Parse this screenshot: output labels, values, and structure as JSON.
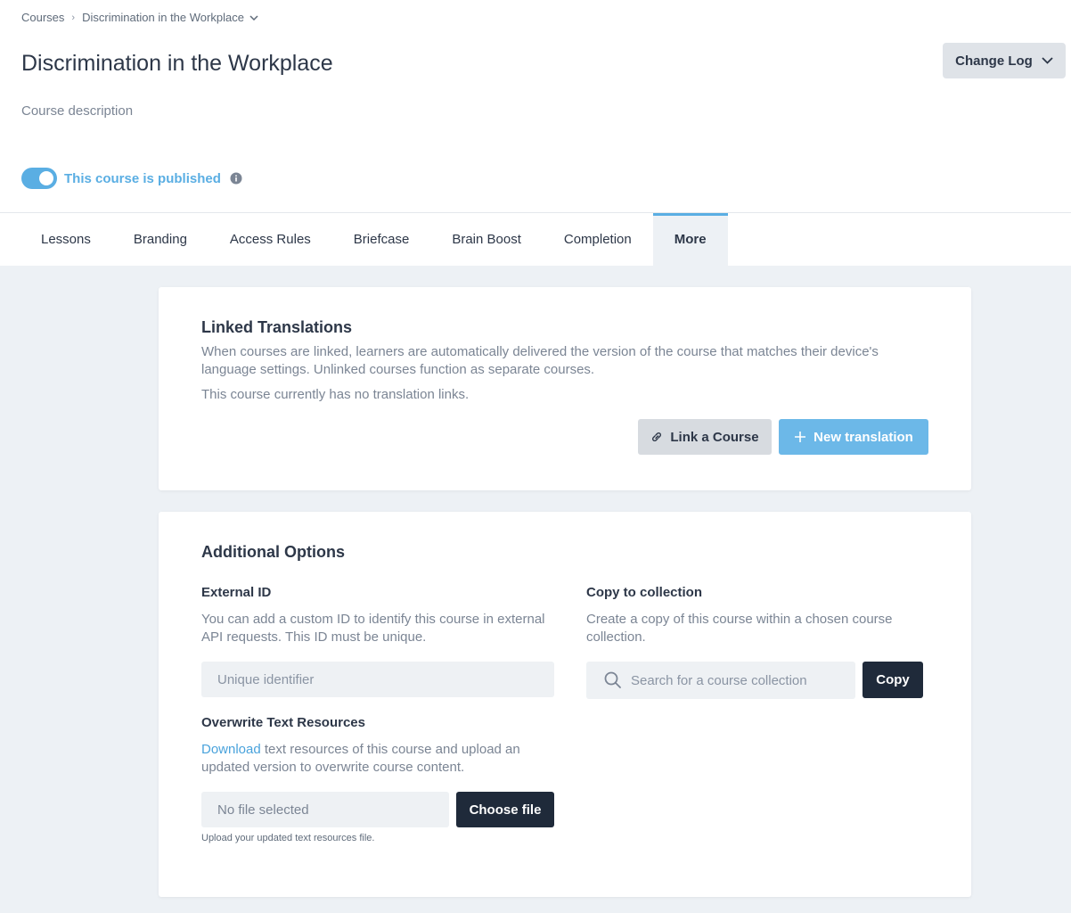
{
  "breadcrumb": {
    "root": "Courses",
    "current": "Discrimination in the Workplace"
  },
  "header": {
    "title": "Discrimination in the Workplace",
    "description": "Course description",
    "change_log_label": "Change Log",
    "publish_status": "This course is published"
  },
  "tabs": [
    {
      "label": "Lessons"
    },
    {
      "label": "Branding"
    },
    {
      "label": "Access Rules"
    },
    {
      "label": "Briefcase"
    },
    {
      "label": "Brain Boost"
    },
    {
      "label": "Completion"
    },
    {
      "label": "More"
    }
  ],
  "linked_translations": {
    "title": "Linked Translations",
    "description": "When courses are linked, learners are automatically delivered the version of the course that matches their device's language settings. Unlinked courses function as separate courses.",
    "status": "This course currently has no translation links.",
    "link_button": "Link a Course",
    "new_button": "New translation"
  },
  "additional_options": {
    "title": "Additional Options",
    "external_id": {
      "label": "External ID",
      "description": "You can add a custom ID to identify this course in external API requests. This ID must be unique.",
      "placeholder": "Unique identifier"
    },
    "copy_collection": {
      "label": "Copy to collection",
      "description": "Create a copy of this course within a chosen course collection.",
      "placeholder": "Search for a course collection",
      "button": "Copy"
    },
    "overwrite": {
      "label": "Overwrite Text Resources",
      "link_text": "Download",
      "description_rest": " text resources of this course and upload an updated version to overwrite course content.",
      "file_status": "No file selected",
      "button": "Choose file",
      "hint": "Upload your updated text resources file."
    }
  },
  "colors": {
    "accent": "#5aaee3",
    "dark_button": "#1f2a3a",
    "background": "#edf1f5"
  }
}
